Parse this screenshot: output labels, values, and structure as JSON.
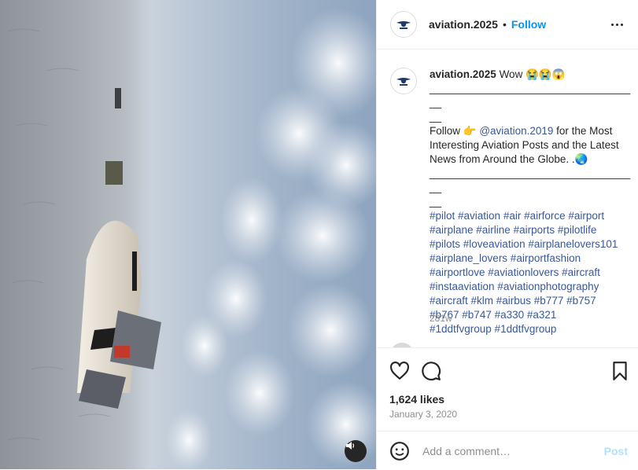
{
  "post": {
    "username": "aviation.2025",
    "follow_label": "Follow",
    "separator": "•"
  },
  "caption": {
    "username": "aviation.2025",
    "title": "Wow 😭😭😱",
    "rule1": "____________________________________",
    "rule1_tail": "__",
    "follow_prefix": "Follow 👉",
    "mention": "@aviation.2019",
    "body_1": "for the Most Interesting Aviation Posts  and the Latest News from Around the Globe. .🌏",
    "rule2": "____________________________________",
    "rule2_tail": "__",
    "hashtags": [
      "#pilot #aviation #air #airforce #airport",
      "#airplane  #airline #airports  #pilotlife",
      "#pilots  #loveaviation #airplanelovers101",
      "#airplane_lovers #airportfashion",
      "#airportlove #aviationlovers #aircraft",
      "#instaaviation #aviationphotography",
      "#aircraft #klm #airbus #b777 #b757",
      "#b767 #b747 #a330 #a321",
      "#1ddtfvgroup #1ddtfvgroup"
    ],
    "age": "281w"
  },
  "engagement": {
    "likes": "1,624 likes",
    "date": "January 3, 2020"
  },
  "comment": {
    "placeholder": "Add a comment…",
    "post_label": "Post"
  },
  "icons": {
    "avatar": "aviation-logo-icon",
    "more": "more-options-icon",
    "like": "heart-icon",
    "comment": "comment-icon",
    "save": "bookmark-icon",
    "emoji": "emoji-icon",
    "mute": "speaker-icon"
  },
  "colors": {
    "accent": "#0095f6",
    "link": "#385898",
    "muted": "#8e8e8e",
    "post_disabled": "#b2dffc"
  }
}
